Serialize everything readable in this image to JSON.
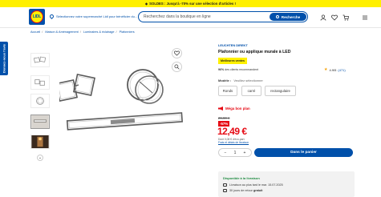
{
  "promo_bar": {
    "text": "SOLDES : Jusqu'à -70% sur une sélection d'articles !"
  },
  "header": {
    "logo_text": "LIDL",
    "store_link": "Sélectionnez votre supermarché Lidl pour bénéficier du...",
    "search": {
      "placeholder": "Recherchez dans la boutique en ligne",
      "button_label": "Recherche"
    },
    "icons": [
      "user-icon",
      "heart-icon",
      "cart-icon",
      "menu-icon"
    ]
  },
  "side_tab": {
    "label": "Donnez-nous l'avis"
  },
  "breadcrumb": {
    "items": [
      "Accueil",
      "Maison & Aménagement",
      "Luminaires & éclairage",
      "Plafonniers"
    ]
  },
  "product": {
    "brand": "LEUCHTEN DIREKT",
    "title": "Plafonnier ou applique murale à LED",
    "badge": "Meilleures ventes",
    "recommend_pct": "96%",
    "recommend_text": "des clients recommandent",
    "rating": "4.9/5",
    "rating_count": "(471)",
    "variant_label": "Modèle :",
    "variant_selection": "Veuillez sélectionner",
    "variants": [
      "Ronds",
      "carré",
      "rectangulaire"
    ]
  },
  "pricing": {
    "deal_label": "Méga bon plan",
    "old_price": "29,90 €",
    "discount": "-57%",
    "price": "12,49 €",
    "unit_price_line1": "Dont 0,08 € d'éco-part.",
    "unit_price_line2": "Frais et délais de livraison"
  },
  "purchase": {
    "quantity": "1",
    "minus": "−",
    "plus": "+",
    "add_to_cart": "Dans le panier"
  },
  "delivery": {
    "title": "Disponible à la livraison",
    "row1": "Livraison au plus tard le mar. 15.07.2025",
    "row2_prefix": "30 jours de retour",
    "row2_highlight": "gratuit"
  },
  "colors": {
    "brand_blue": "#0050aa",
    "brand_yellow": "#fff000",
    "sale_red": "#e60a14"
  }
}
